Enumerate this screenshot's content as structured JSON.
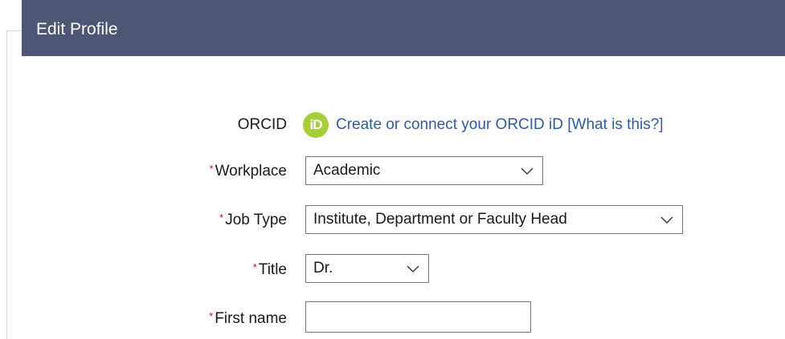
{
  "panel": {
    "title": "Edit Profile"
  },
  "orcid": {
    "label": "ORCID",
    "icon_text": "iD",
    "link_text": "Create or connect your ORCID iD [What is this?]",
    "icon_color": "#a6ce39",
    "link_color": "#2f5b9e"
  },
  "form": {
    "required_marker": "*",
    "workplace": {
      "label": "Workplace",
      "value": "Academic"
    },
    "job_type": {
      "label": "Job Type",
      "value": "Institute, Department or Faculty Head"
    },
    "title": {
      "label": "Title",
      "value": "Dr."
    },
    "first_name": {
      "label": "First name",
      "value": ""
    }
  },
  "colors": {
    "header_bg": "#4d5674",
    "required": "#c8102e"
  }
}
